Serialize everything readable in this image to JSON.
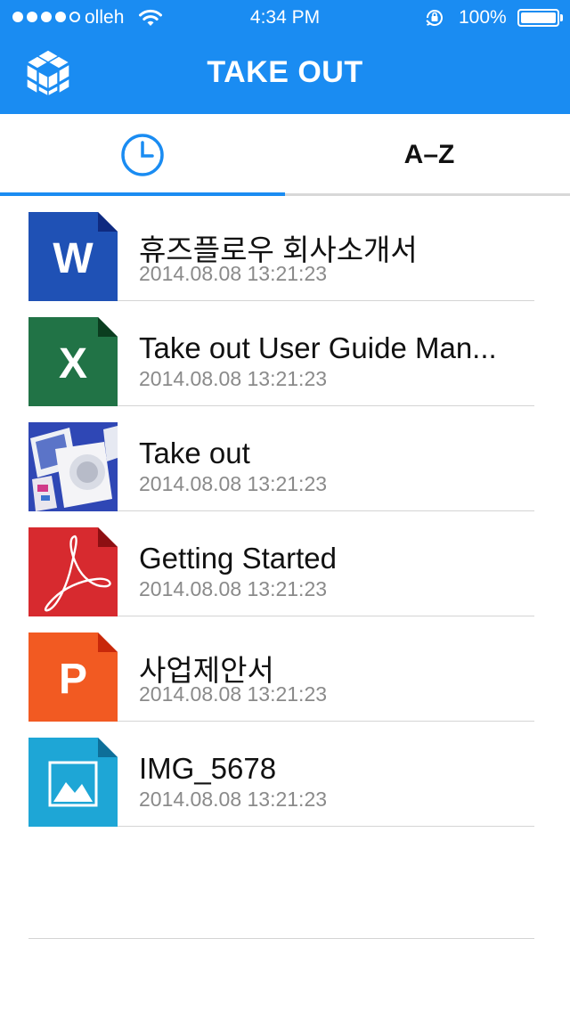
{
  "status_bar": {
    "carrier": "olleh",
    "time": "4:34 PM",
    "battery_percent": "100%",
    "signal_bars": 4,
    "signal_max": 5,
    "battery_level": 1.0
  },
  "header": {
    "title": "TAKE OUT"
  },
  "tabs": [
    {
      "label": "",
      "icon": "clock-icon",
      "active": true
    },
    {
      "label": "A–Z",
      "icon": "",
      "active": false
    }
  ],
  "files": [
    {
      "name": "휴즈플로우 회사소개서",
      "date": "2014.08.08 13:21:23",
      "type": "word",
      "icon_letter": "W",
      "color": "#1f51b5",
      "fold": "#0f2a80"
    },
    {
      "name": "Take out User Guide Man...",
      "date": "2014.08.08 13:21:23",
      "type": "excel",
      "icon_letter": "X",
      "color": "#217346",
      "fold": "#0b3d1f"
    },
    {
      "name": "Take out",
      "date": "2014.08.08 13:21:23",
      "type": "photo",
      "icon_letter": "",
      "color": "#2a3fa8",
      "fold": ""
    },
    {
      "name": "Getting Started",
      "date": "2014.08.08 13:21:23",
      "type": "pdf",
      "icon_letter": "",
      "color": "#d72a2f",
      "fold": "#8e0f12"
    },
    {
      "name": "사업제안서",
      "date": "2014.08.08 13:21:23",
      "type": "powerpoint",
      "icon_letter": "P",
      "color": "#f25a22",
      "fold": "#c8280a"
    },
    {
      "name": "IMG_5678",
      "date": "2014.08.08 13:21:23",
      "type": "image",
      "icon_letter": "",
      "color": "#1ea6d6",
      "fold": "#0e6f99"
    }
  ],
  "colors": {
    "accent": "#1a8cf2",
    "date_text": "#8a8a8a",
    "divider": "#d4d4d4"
  }
}
